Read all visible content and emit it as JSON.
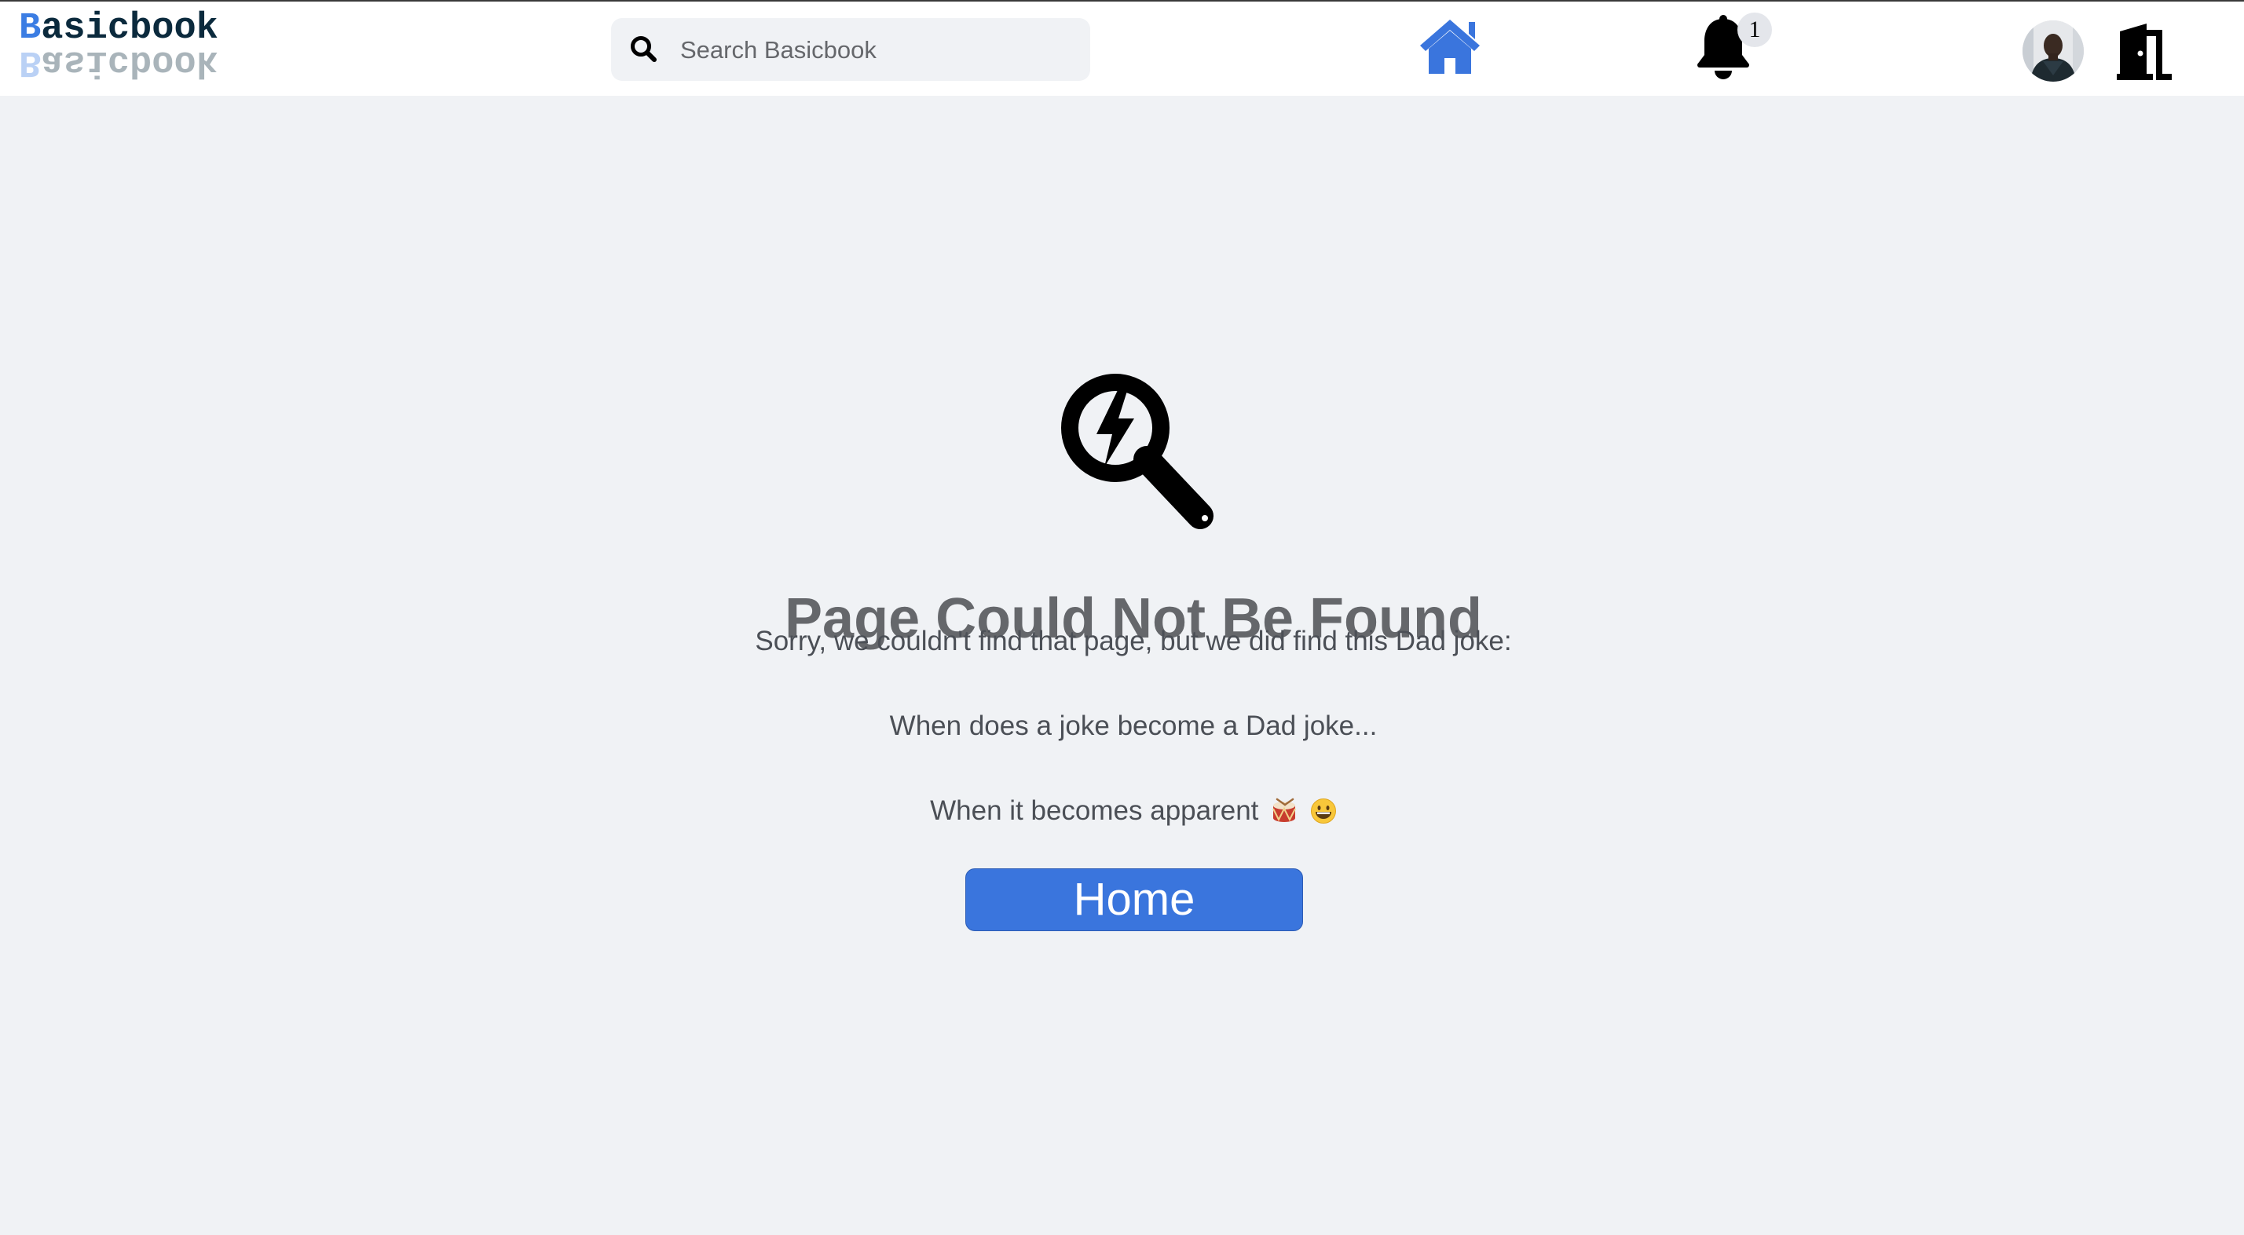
{
  "app": {
    "logo_first": "B",
    "logo_rest": "asicbook"
  },
  "header": {
    "search_placeholder": "Search Basicbook",
    "notification_count": "1",
    "icons": {
      "search": "search-icon",
      "home": "home-icon",
      "notifications": "bell-icon",
      "avatar": "user-avatar",
      "logout": "door-exit-icon"
    }
  },
  "error_page": {
    "icon": "search-bolt-icon",
    "title": "Page Could Not Be Found",
    "message": "Sorry, we couldn't find that page, but we did find this Dad joke:",
    "joke_setup": "When does a joke become a Dad joke...",
    "joke_punchline": "When it becomes apparent",
    "emojis": [
      "drum-emoji",
      "grinning-face-emoji"
    ],
    "home_button": "Home"
  },
  "colors": {
    "accent": "#3a75dd",
    "page_background": "#f0f2f5",
    "title_text": "#65676b",
    "logo_dark": "#0b2a3d",
    "logo_blue": "#3b7de3"
  }
}
